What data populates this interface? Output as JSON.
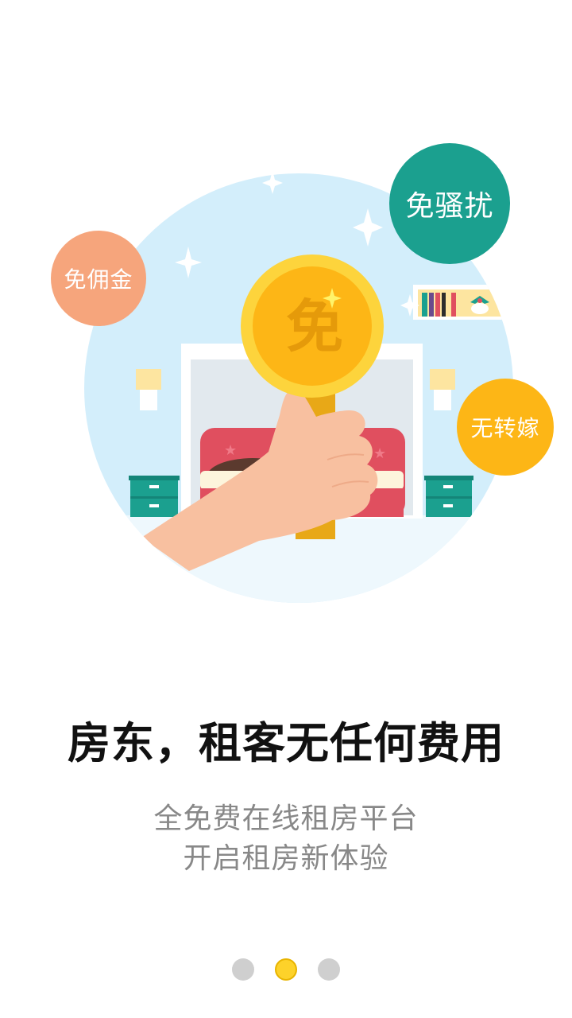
{
  "illustration": {
    "coin_char": "免",
    "badges": {
      "commission": "免佣金",
      "harassment": "免骚扰",
      "transfer": "无转嫁"
    }
  },
  "headline": "房东，租客无任何费用",
  "subtitle_line1": "全免费在线租房平台",
  "subtitle_line2": "开启租房新体验",
  "pager": {
    "total": 3,
    "active_index": 2
  },
  "colors": {
    "circle_bg": "#d3eefb",
    "coin": "#fdb616",
    "badge_commission": "#f6a57c",
    "badge_harassment": "#1ba08f",
    "badge_transfer": "#fdb616",
    "dot_active": "#fdd22a",
    "dot_inactive": "#cfcfcf"
  }
}
